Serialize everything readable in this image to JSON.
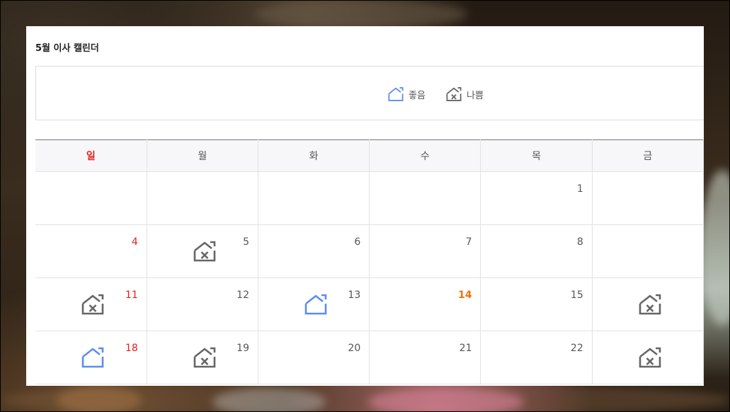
{
  "calendar": {
    "title": "5월 이사 캘린더",
    "legend": {
      "good": {
        "label": "좋음",
        "icon": "house-good-icon",
        "color": "#5b8def"
      },
      "bad": {
        "label": "나쁨",
        "icon": "house-bad-icon",
        "color": "#666666"
      }
    },
    "weekdays": [
      "일",
      "월",
      "화",
      "수",
      "목",
      "금"
    ],
    "weeks": [
      [
        {
          "day": "",
          "mark": ""
        },
        {
          "day": "",
          "mark": ""
        },
        {
          "day": "",
          "mark": ""
        },
        {
          "day": "",
          "mark": ""
        },
        {
          "day": "1",
          "mark": ""
        },
        {
          "day": "",
          "mark": ""
        }
      ],
      [
        {
          "day": "4",
          "mark": ""
        },
        {
          "day": "5",
          "mark": "bad"
        },
        {
          "day": "6",
          "mark": ""
        },
        {
          "day": "7",
          "mark": ""
        },
        {
          "day": "8",
          "mark": ""
        },
        {
          "day": "",
          "mark": ""
        }
      ],
      [
        {
          "day": "11",
          "mark": "bad"
        },
        {
          "day": "12",
          "mark": ""
        },
        {
          "day": "13",
          "mark": "good"
        },
        {
          "day": "14",
          "mark": "",
          "today": true
        },
        {
          "day": "15",
          "mark": ""
        },
        {
          "day": "",
          "mark": "bad"
        }
      ],
      [
        {
          "day": "18",
          "mark": "good"
        },
        {
          "day": "19",
          "mark": "bad"
        },
        {
          "day": "20",
          "mark": ""
        },
        {
          "day": "21",
          "mark": ""
        },
        {
          "day": "22",
          "mark": ""
        },
        {
          "day": "",
          "mark": "bad"
        }
      ]
    ],
    "colors": {
      "sunday": "#e0201b",
      "today": "#f2700c",
      "good": "#5b8def",
      "bad": "#666666"
    }
  }
}
